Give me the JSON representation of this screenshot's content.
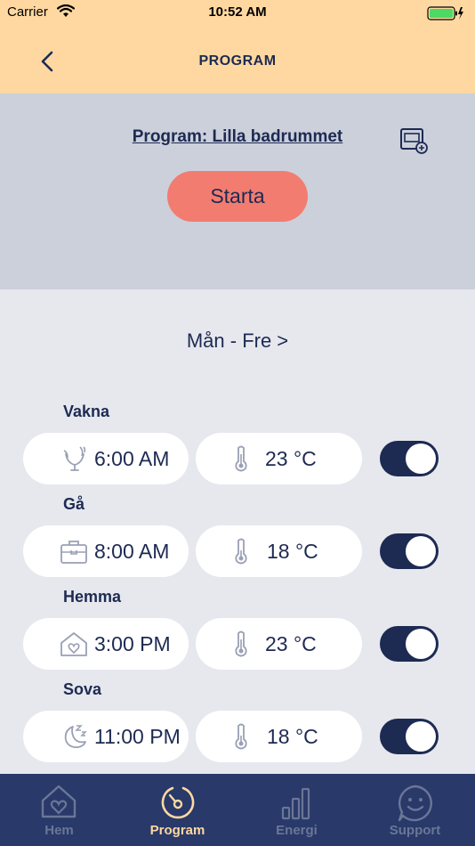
{
  "status_bar": {
    "carrier": "Carrier",
    "time": "10:52 AM"
  },
  "nav": {
    "title": "PROGRAM"
  },
  "program": {
    "name": "Program: Lilla badrummet",
    "start_label": "Starta"
  },
  "schedule": {
    "day_range": "Mån - Fre >",
    "periods": [
      {
        "label": "Vakna",
        "time": "6:00 AM",
        "temp": "23 °C",
        "icon": "rooster-icon",
        "enabled": true
      },
      {
        "label": "Gå",
        "time": "8:00 AM",
        "temp": "18 °C",
        "icon": "briefcase-icon",
        "enabled": true
      },
      {
        "label": "Hemma",
        "time": "3:00 PM",
        "temp": "23 °C",
        "icon": "home-heart-icon",
        "enabled": true
      },
      {
        "label": "Sova",
        "time": "11:00 PM",
        "temp": "18 °C",
        "icon": "moon-sleep-icon",
        "enabled": true
      }
    ]
  },
  "tabs": [
    {
      "label": "Hem",
      "icon": "home-heart-icon",
      "active": false
    },
    {
      "label": "Program",
      "icon": "dial-icon",
      "active": true
    },
    {
      "label": "Energi",
      "icon": "bar-chart-icon",
      "active": false
    },
    {
      "label": "Support",
      "icon": "smile-chat-icon",
      "active": false
    }
  ],
  "colors": {
    "header": "#fed8a0",
    "accent_button": "#f27c70",
    "navy": "#1d2a52",
    "tab_bar": "#28396a"
  }
}
